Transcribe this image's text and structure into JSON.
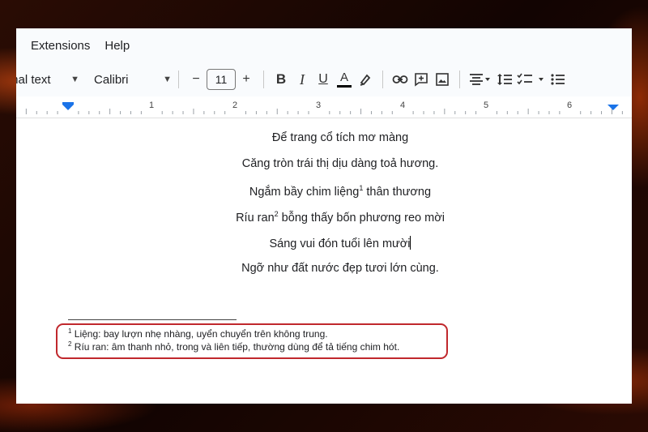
{
  "menu": {
    "extensions": "Extensions",
    "help": "Help"
  },
  "toolbar": {
    "style_value": "mal text",
    "font_value": "Calibri",
    "font_size": "11",
    "bold": "B",
    "italic": "I",
    "underline": "U",
    "text_color": "A",
    "decrease": "−",
    "increase": "+"
  },
  "ruler": {
    "labels": [
      "1",
      "2",
      "3",
      "4",
      "5",
      "6"
    ]
  },
  "poem": {
    "line1": "Để trang cổ tích mơ màng",
    "line2": "Căng tròn trái thị dịu dàng toả hương.",
    "line3_a": "Ngắm bầy chim liệng",
    "line3_sup": "1",
    "line3_b": " thân thương",
    "line4_a": "Ríu ran",
    "line4_sup": "2",
    "line4_b": " bỗng thấy bốn phương reo mời",
    "line5": "Sáng vui đón tuổi lên mười",
    "line6": "Ngỡ như đất nước đẹp tươi lớn cùng."
  },
  "footnotes": {
    "n1": "1",
    "t1": " Liệng: bay lượn nhẹ nhàng, uyển chuyển trên không trung.",
    "n2": "2",
    "t2": " Ríu ran: âm thanh nhỏ, trong và liên tiếp, thường dùng để tả tiếng chim hót."
  },
  "colors": {
    "highlight_border": "#c0282d",
    "ruler_marker": "#1a73e8"
  }
}
